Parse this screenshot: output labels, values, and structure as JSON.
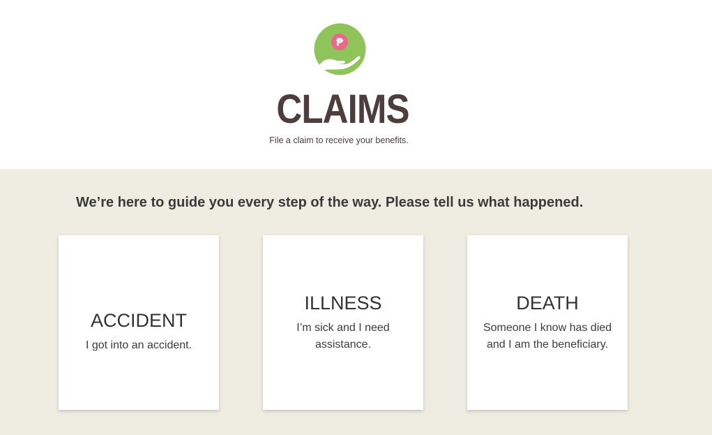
{
  "header": {
    "logo_icon": "peso-coin-in-hand-icon",
    "logo_symbol": "₱",
    "title": "CLAIMS",
    "subtitle": "File a claim to receive your benefits."
  },
  "main": {
    "lead": "We’re here to guide you every step of the way. Please tell us what happened.",
    "cards": [
      {
        "title": "ACCIDENT",
        "description": "I got into an accident."
      },
      {
        "title": "ILLNESS",
        "description": "I’m sick and I need assistance."
      },
      {
        "title": "DEATH",
        "description": "Someone I know has died and I am the beneficiary."
      }
    ]
  },
  "colors": {
    "brand_dark": "#4d3d3d",
    "logo_green": "#8fc45a",
    "coin_pink": "#e8698a",
    "band_background": "#efede1"
  }
}
